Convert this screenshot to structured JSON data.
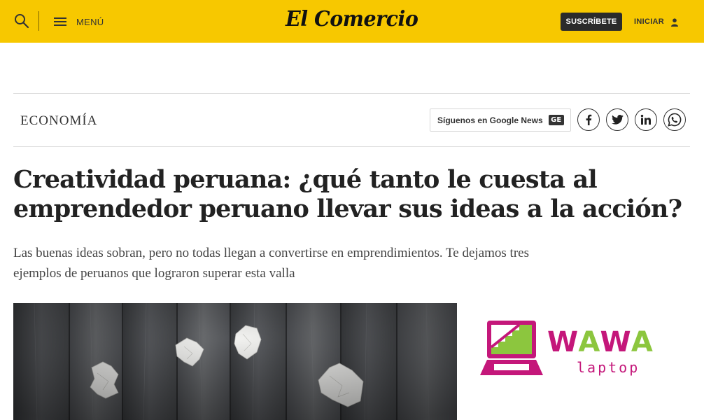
{
  "header": {
    "menu_label": "MENÚ",
    "logo_text": "El Comercio",
    "subscribe_label": "SUSCRÍBETE",
    "login_label": "INICIAR"
  },
  "section": {
    "name": "ECONOMÍA",
    "google_news_label": "Síguenos en Google News",
    "google_news_badge": "GE",
    "social": [
      "facebook-icon",
      "twitter-icon",
      "linkedin-icon",
      "whatsapp-icon"
    ]
  },
  "article": {
    "title_line1": "Creatividad peruana: ¿qué tanto le cuesta al",
    "title_line2": "emprendedor peruano llevar sus ideas a la acción?",
    "subtitle_line1": "Las buenas ideas sobran, pero no todas llegan a convertirse en emprendimientos. Te dejamos tres",
    "subtitle_line2": "ejemplos de peruanos que lograron superar esta valla"
  },
  "ad": {
    "brand": "WAWA",
    "tagline": "laptop"
  },
  "colors": {
    "brand_yellow": "#f7c800",
    "ad_magenta": "#c4177a",
    "ad_green": "#8cc63e"
  }
}
